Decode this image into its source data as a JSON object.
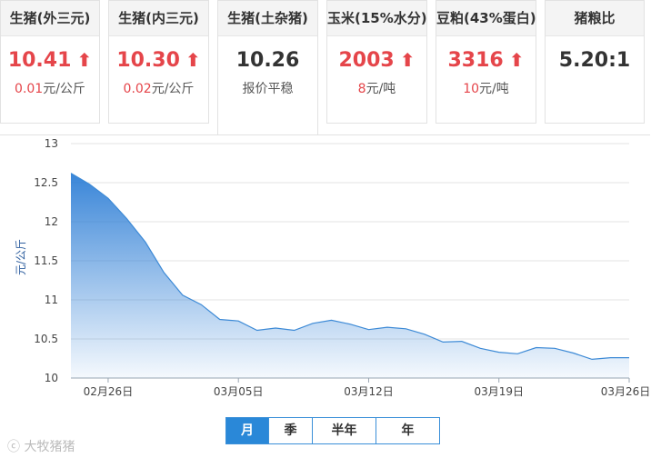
{
  "cards": [
    {
      "title": "生猪(外三元)",
      "price": "10.41",
      "arrow": "⬆",
      "change": "0.01",
      "unit": "元/公斤"
    },
    {
      "title": "生猪(内三元)",
      "price": "10.30",
      "arrow": "⬆",
      "change": "0.02",
      "unit": "元/公斤"
    },
    {
      "title": "生猪(土杂猪)",
      "price": "10.26",
      "sub": "报价平稳"
    },
    {
      "title": "玉米(15%水分)",
      "price": "2003",
      "arrow": "⬆",
      "change": "8",
      "unit": "元/吨"
    },
    {
      "title": "豆粕(43%蛋白)",
      "price": "3316",
      "arrow": "⬆",
      "change": "10",
      "unit": "元/吨"
    },
    {
      "title": "猪粮比",
      "price": "5.20:1"
    }
  ],
  "periods": [
    "月",
    "季",
    "半年",
    "年"
  ],
  "active_period": "月",
  "watermark": "大牧猪猪",
  "colors": {
    "accent": "#2a88d8",
    "up": "#e5454a",
    "fill_top": "#2f7fd6",
    "line": "#3d8ad6"
  },
  "chart_data": {
    "type": "area",
    "ylabel": "元/公斤",
    "xlabel": "",
    "ylim": [
      10,
      13
    ],
    "yticks": [
      "10",
      "10.5",
      "11",
      "11.5",
      "12",
      "12.5",
      "13"
    ],
    "xticks": [
      "02月26日",
      "03月05日",
      "03月12日",
      "03月19日",
      "03月26日"
    ],
    "x": [
      "02-24",
      "02-25",
      "02-26",
      "02-27",
      "02-28",
      "03-01",
      "03-02",
      "03-03",
      "03-04",
      "03-05",
      "03-06",
      "03-07",
      "03-08",
      "03-09",
      "03-10",
      "03-11",
      "03-12",
      "03-13",
      "03-14",
      "03-15",
      "03-16",
      "03-17",
      "03-18",
      "03-19",
      "03-20",
      "03-21",
      "03-22",
      "03-23",
      "03-24",
      "03-25",
      "03-26"
    ],
    "values": [
      12.62,
      12.48,
      12.3,
      12.04,
      11.74,
      11.35,
      11.06,
      10.94,
      10.75,
      10.73,
      10.61,
      10.64,
      10.61,
      10.7,
      10.74,
      10.69,
      10.62,
      10.65,
      10.63,
      10.56,
      10.46,
      10.47,
      10.38,
      10.33,
      10.31,
      10.39,
      10.38,
      10.32,
      10.24,
      10.26,
      10.26
    ],
    "grid": true,
    "legend": "none"
  }
}
